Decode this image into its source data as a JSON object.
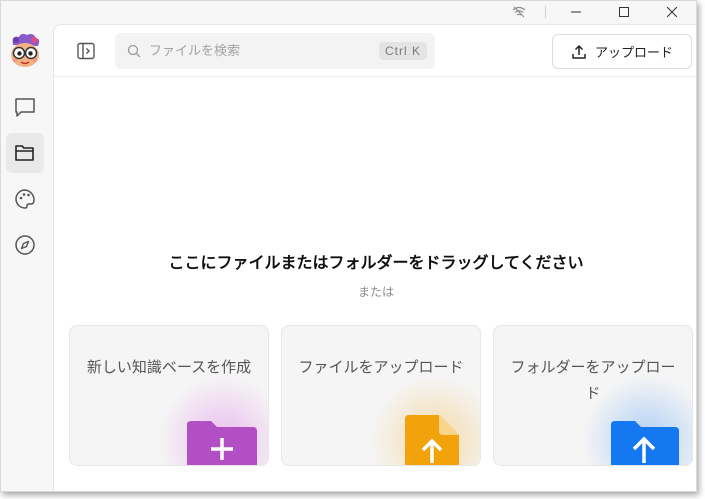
{
  "colors": {
    "purple_folder": "#b24fc4",
    "orange_file": "#f2a20b",
    "blue_folder": "#1478f0"
  },
  "search": {
    "placeholder": "ファイルを検索",
    "shortcut": "Ctrl  K"
  },
  "toolbar": {
    "upload_label": "アップロード"
  },
  "dropzone": {
    "title": "ここにファイルまたはフォルダーをドラッグしてください",
    "or_text": "または"
  },
  "cards": [
    {
      "label": "新しい知識ベースを作成",
      "icon": "folder-plus-icon"
    },
    {
      "label": "ファイルをアップロード",
      "icon": "file-upload-icon"
    },
    {
      "label": "フォルダーをアップロード",
      "icon": "folder-upload-icon"
    }
  ]
}
